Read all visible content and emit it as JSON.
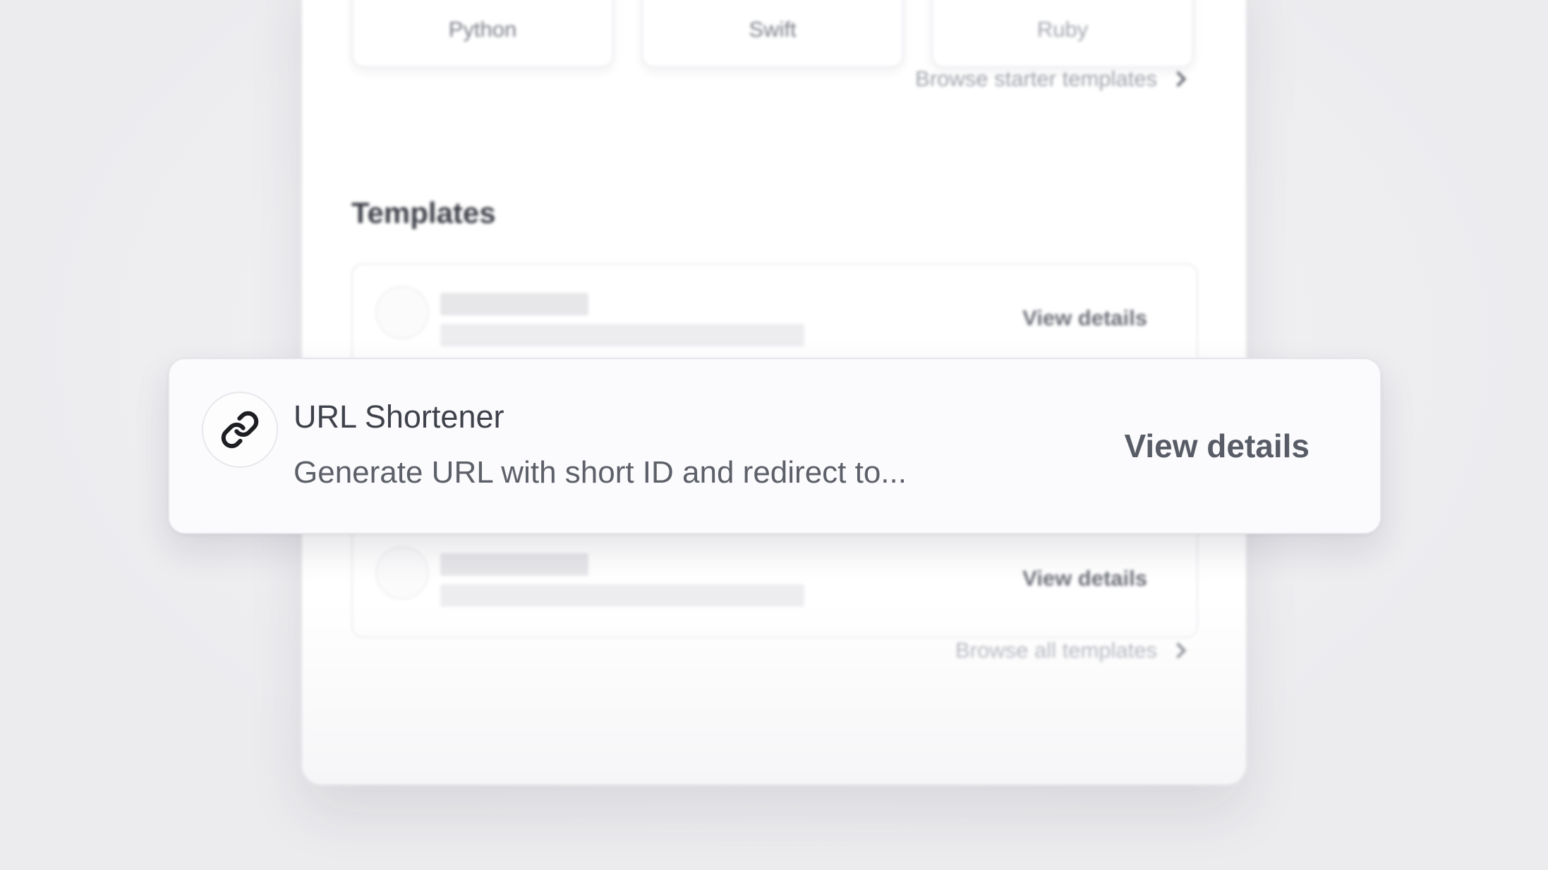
{
  "languages": {
    "items": [
      "Python",
      "Swift",
      "Ruby"
    ],
    "browse_starter_label": "Browse starter templates"
  },
  "templates": {
    "section_title": "Templates",
    "view_details_label": "View details",
    "browse_all_label": "Browse all templates",
    "focused": {
      "title": "URL Shortener",
      "description": "Generate URL with short ID and redirect to...",
      "icon": "link-icon",
      "action_label": "View details"
    }
  }
}
